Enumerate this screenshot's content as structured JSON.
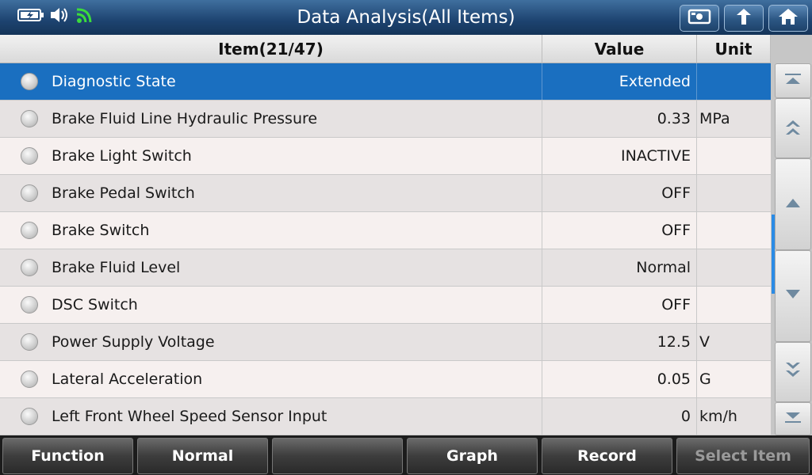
{
  "header": {
    "title": "Data Analysis(All Items)",
    "icons": [
      "battery-icon",
      "speaker-icon",
      "wifi-icon"
    ],
    "buttons": [
      "report-icon",
      "up-arrow-icon",
      "home-icon"
    ]
  },
  "table": {
    "columns": {
      "item": "Item(21/47)",
      "value": "Value",
      "unit": "Unit"
    },
    "rows": [
      {
        "name": "Diagnostic State",
        "value": "Extended",
        "unit": "",
        "selected": true
      },
      {
        "name": "Brake Fluid Line Hydraulic Pressure",
        "value": "0.33",
        "unit": "MPa"
      },
      {
        "name": "Brake Light Switch",
        "value": "INACTIVE",
        "unit": ""
      },
      {
        "name": "Brake Pedal Switch",
        "value": "OFF",
        "unit": ""
      },
      {
        "name": "Brake Switch",
        "value": "OFF",
        "unit": ""
      },
      {
        "name": "Brake Fluid Level",
        "value": "Normal",
        "unit": ""
      },
      {
        "name": "DSC Switch",
        "value": "OFF",
        "unit": ""
      },
      {
        "name": "Power Supply Voltage",
        "value": "12.5",
        "unit": "V"
      },
      {
        "name": "Lateral Acceleration",
        "value": "0.05",
        "unit": "G"
      },
      {
        "name": "Left Front Wheel Speed Sensor Input",
        "value": "0",
        "unit": "km/h"
      }
    ]
  },
  "scroll": {
    "buttons": [
      "scroll-top-icon",
      "page-up-icon",
      "line-up-icon",
      "line-down-icon",
      "page-down-icon",
      "scroll-bottom-icon"
    ],
    "position_fraction": 0.45
  },
  "footer": {
    "buttons": [
      {
        "label": "Function",
        "enabled": true
      },
      {
        "label": "Normal",
        "enabled": true
      },
      {
        "label": "",
        "enabled": true
      },
      {
        "label": "Graph",
        "enabled": true
      },
      {
        "label": "Record",
        "enabled": true
      },
      {
        "label": "Select Item",
        "enabled": false
      }
    ]
  },
  "colors": {
    "selected_row": "#1a6fc0",
    "row_even": "#e6e2e2",
    "row_odd": "#f6f0ef",
    "scroll_thumb": "#2a8be6"
  }
}
